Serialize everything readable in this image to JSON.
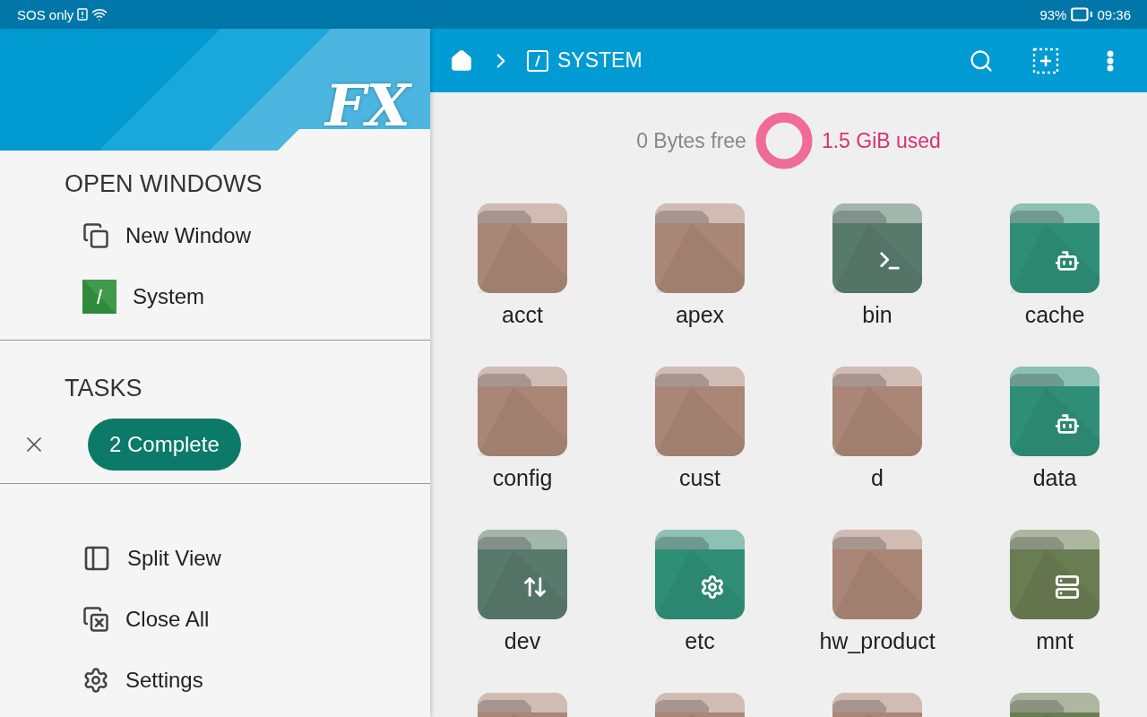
{
  "status_bar": {
    "carrier": "SOS only",
    "battery": "93%",
    "time": "09:36"
  },
  "drawer": {
    "logo": "FX",
    "open_windows": {
      "title": "OPEN WINDOWS",
      "items": [
        {
          "kind": "new",
          "label": "New Window"
        },
        {
          "kind": "system",
          "label": "System"
        }
      ]
    },
    "tasks": {
      "title": "TASKS",
      "status": "2 Complete"
    },
    "actions": [
      {
        "kind": "split",
        "label": "Split View"
      },
      {
        "kind": "close",
        "label": "Close All"
      },
      {
        "kind": "settings",
        "label": "Settings"
      }
    ]
  },
  "toolbar": {
    "location": "SYSTEM"
  },
  "storage": {
    "free": "0 Bytes free",
    "used": "1.5 GiB used",
    "level": 1
  },
  "folders": [
    {
      "name": "acct",
      "kind": "plain",
      "color": "#a98675"
    },
    {
      "name": "apex",
      "kind": "plain",
      "color": "#a98675"
    },
    {
      "name": "bin",
      "kind": "terminal",
      "color": "#587a6c"
    },
    {
      "name": "cache",
      "kind": "android",
      "color": "#2e8f76"
    },
    {
      "name": "config",
      "kind": "plain",
      "color": "#a98675"
    },
    {
      "name": "cust",
      "kind": "plain",
      "color": "#a98675"
    },
    {
      "name": "d",
      "kind": "plain",
      "color": "#a98675"
    },
    {
      "name": "data",
      "kind": "android",
      "color": "#2e8f76"
    },
    {
      "name": "dev",
      "kind": "transfer",
      "color": "#587a6c"
    },
    {
      "name": "etc",
      "kind": "gear",
      "color": "#2e8f76"
    },
    {
      "name": "hw_product",
      "kind": "plain",
      "color": "#a98675"
    },
    {
      "name": "mnt",
      "kind": "storage",
      "color": "#6a7c52"
    },
    {
      "kind": "plain",
      "color": "#a98675"
    },
    {
      "kind": "plain",
      "color": "#a98675"
    },
    {
      "kind": "plain",
      "color": "#a98675"
    },
    {
      "kind": "plain",
      "color": "#6a7c52"
    }
  ]
}
